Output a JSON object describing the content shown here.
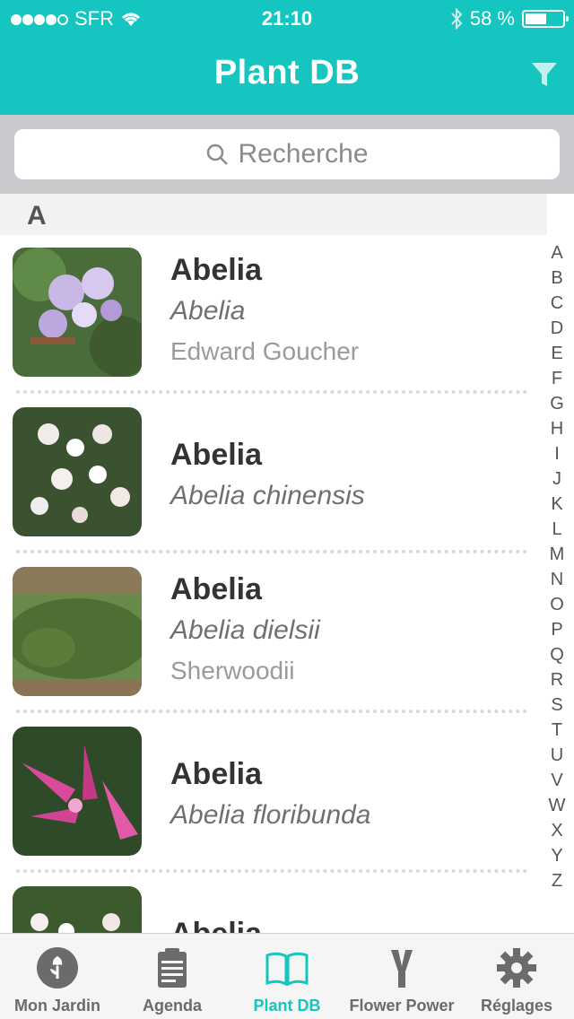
{
  "status": {
    "dots": 4,
    "carrier": "SFR",
    "time": "21:10",
    "battery": "58 %",
    "battery_level": 0.58
  },
  "nav": {
    "title": "Plant DB"
  },
  "search": {
    "placeholder": "Recherche"
  },
  "section": {
    "letter": "A"
  },
  "plants": [
    {
      "common": "Abelia",
      "latin": "Abelia",
      "cultivar": "Edward Goucher"
    },
    {
      "common": "Abelia",
      "latin": "Abelia chinensis",
      "cultivar": ""
    },
    {
      "common": "Abelia",
      "latin": "Abelia dielsii",
      "cultivar": "Sherwoodii"
    },
    {
      "common": "Abelia",
      "latin": "Abelia floribunda",
      "cultivar": ""
    },
    {
      "common": "Abelia",
      "latin": "",
      "cultivar": ""
    }
  ],
  "index": [
    "A",
    "B",
    "C",
    "D",
    "E",
    "F",
    "G",
    "H",
    "I",
    "J",
    "K",
    "L",
    "M",
    "N",
    "O",
    "P",
    "Q",
    "R",
    "S",
    "T",
    "U",
    "V",
    "W",
    "X",
    "Y",
    "Z"
  ],
  "tabs": [
    {
      "label": "Mon Jardin",
      "icon": "flower-icon"
    },
    {
      "label": "Agenda",
      "icon": "clipboard-icon"
    },
    {
      "label": "Plant DB",
      "icon": "book-icon"
    },
    {
      "label": "Flower Power",
      "icon": "sensor-icon"
    },
    {
      "label": "Réglages",
      "icon": "gear-icon"
    }
  ],
  "colors": {
    "accent": "#14c6bf",
    "tab_inactive": "#6b6b6b"
  }
}
